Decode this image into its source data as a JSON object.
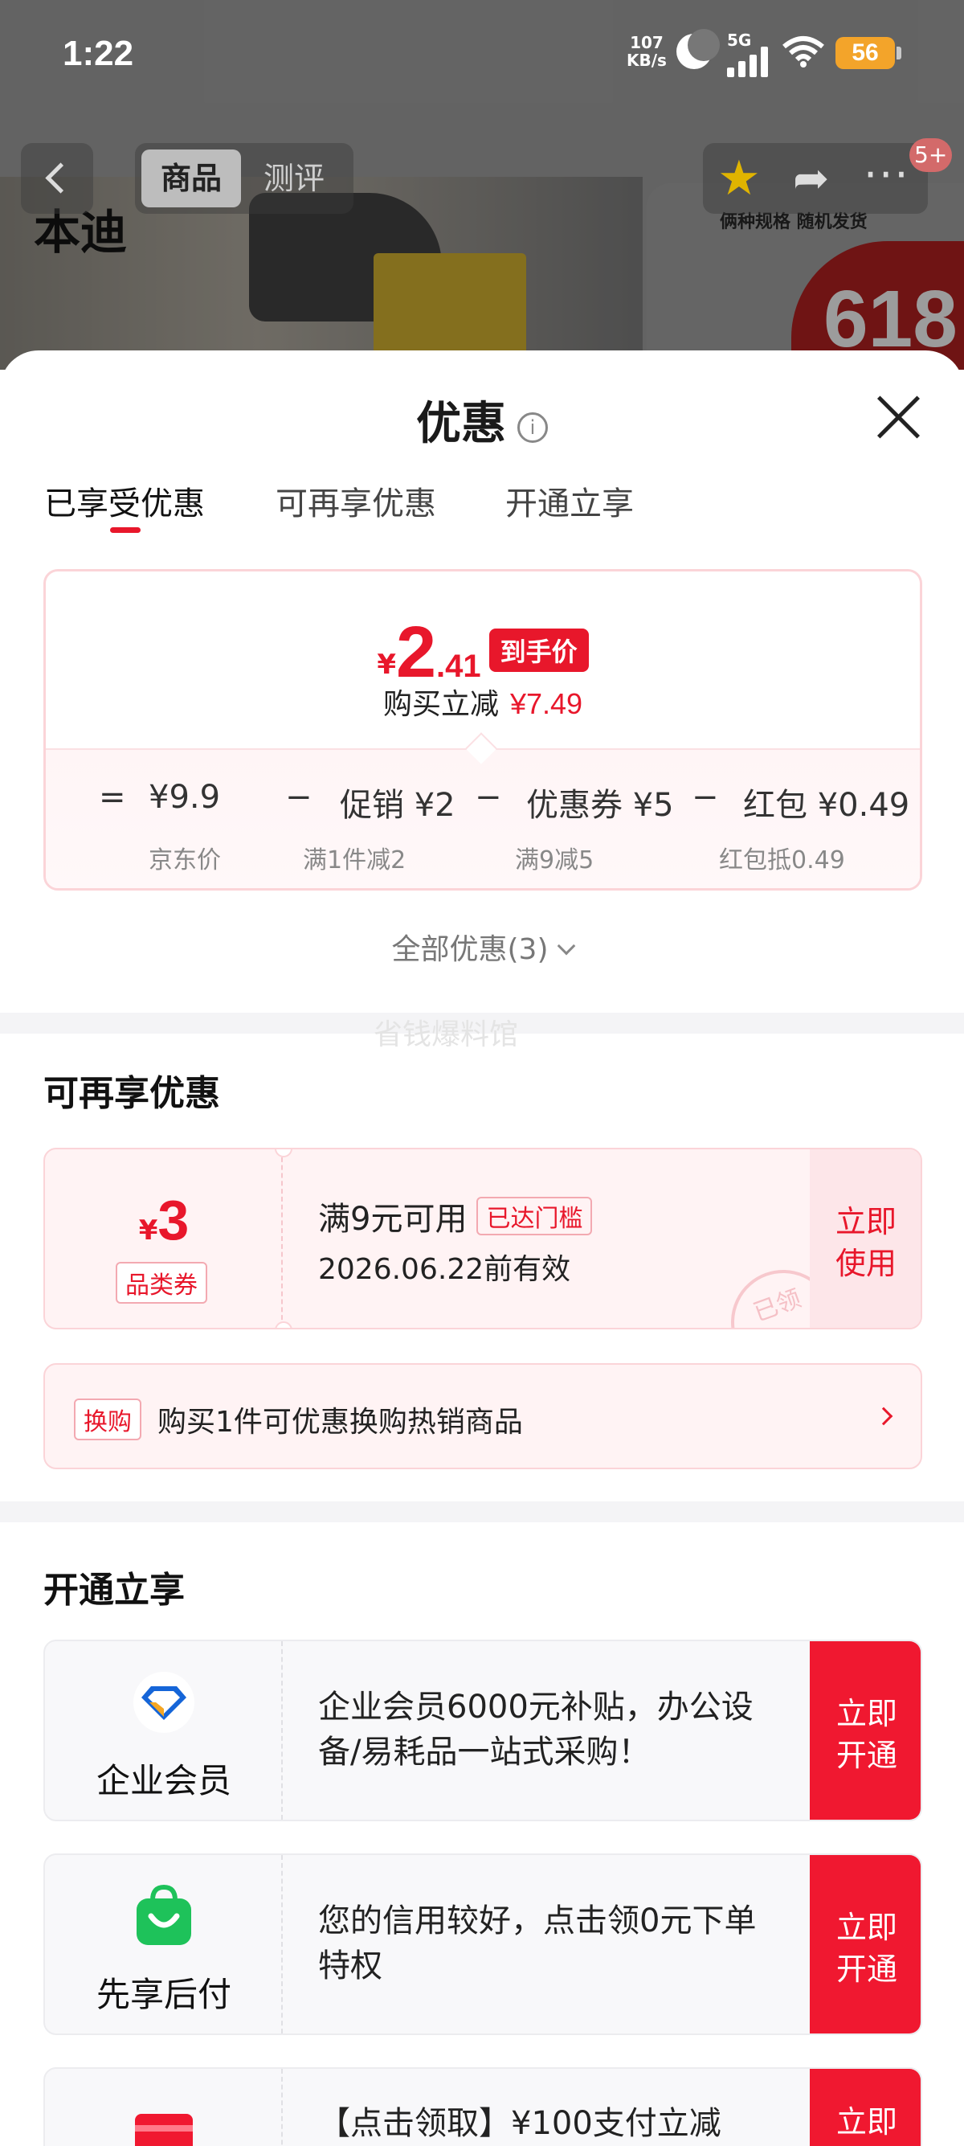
{
  "status_bar": {
    "time": "1:22",
    "net_speed_value": "107",
    "net_speed_unit": "KB/s",
    "network": "5G",
    "battery": "56"
  },
  "product_nav": {
    "tab_active": "商品",
    "tab_inactive": "测评",
    "badge": "5+",
    "brand_text": "本迪",
    "ribbon_text": "俩种规格 随机发货",
    "promo_text": "618"
  },
  "sheet": {
    "title": "优惠",
    "info_glyph": "i",
    "tabs": [
      "已享受优惠",
      "可再享优惠",
      "开通立享"
    ]
  },
  "price_card": {
    "yen": "¥",
    "price_int": "2",
    "price_dec": ".41",
    "price_tag": "到手价",
    "cut_label": "购买立减",
    "cut_amount": "¥7.49",
    "eq": "=",
    "minus": "−",
    "items": [
      {
        "label": "¥9.9",
        "sub": "京东价"
      },
      {
        "label": "促销 ¥2",
        "sub": "满1件减2"
      },
      {
        "label": "优惠券 ¥5",
        "sub": "满9减5"
      },
      {
        "label": "红包 ¥0.49",
        "sub": "红包抵0.49"
      }
    ]
  },
  "all_promos": "全部优惠(3)",
  "watermark": "省钱爆料馆",
  "more_section": {
    "title": "可再享优惠",
    "coupon": {
      "yen": "¥",
      "amount": "3",
      "type": "品类券",
      "condition": "满9元可用",
      "reached": "已达门槛",
      "valid_until": "2026.06.22前有效",
      "use_line1": "立即",
      "use_line2": "使用",
      "stamp": "已领"
    },
    "swap": {
      "tag": "换购",
      "text": "购买1件可优惠换购热销商品"
    }
  },
  "open_section": {
    "title": "开通立享",
    "cards": [
      {
        "name": "企业会员",
        "desc": "企业会员6000元补贴，办公设备/易耗品一站式采购！",
        "btn1": "立即",
        "btn2": "开通",
        "icon": "enterprise-diamond-icon"
      },
      {
        "name": "先享后付",
        "desc": "您的信用较好，点击领0元下单特权",
        "btn1": "立即",
        "btn2": "开通",
        "icon": "green-bag-icon"
      },
      {
        "name": "",
        "desc": "【点击领取】¥100支付立减",
        "btn1": "立即",
        "btn2": "",
        "icon": "red-card-icon"
      }
    ]
  },
  "colors": {
    "accent": "#e8172b",
    "button": "#f01830",
    "coupon_bg": "#fff3f4",
    "card_bg": "#f8f8fa"
  }
}
